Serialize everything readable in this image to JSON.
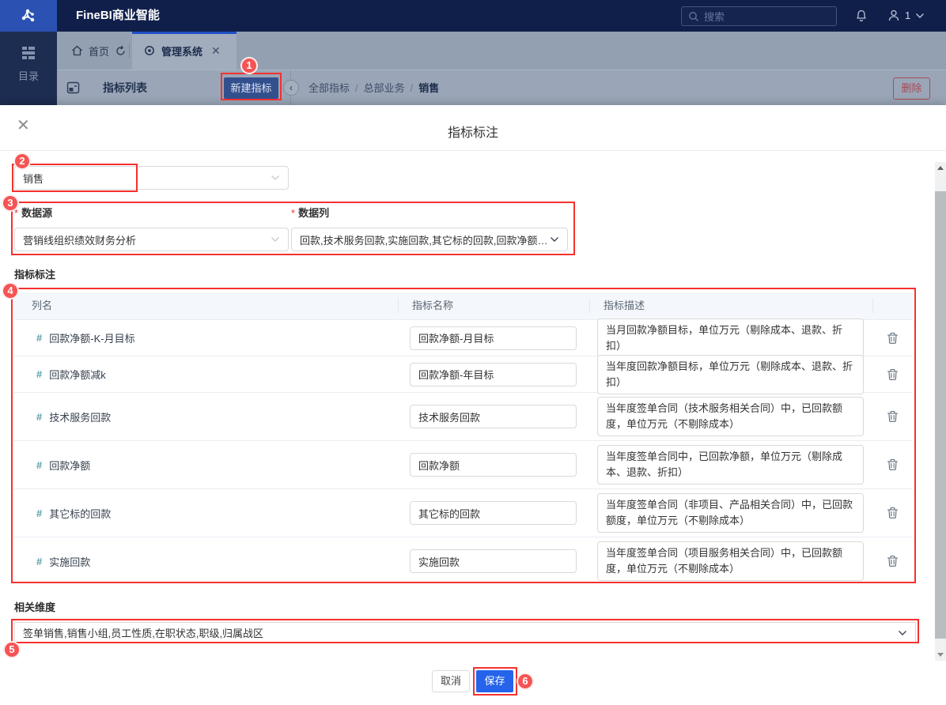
{
  "header": {
    "brand": "FineBI商业智能",
    "search_placeholder": "搜索",
    "user_number": "1"
  },
  "sidebar": {
    "catalog_label": "目录"
  },
  "tabs": {
    "home_label": "首页",
    "active_label": "管理系统"
  },
  "toolbar": {
    "panel_title": "指标列表",
    "new_button_label": "新建指标",
    "breadcrumb": [
      "全部指标",
      "总部业务",
      "销售"
    ],
    "breadcrumb_separator": "/",
    "delete_button_label": "删除"
  },
  "modal": {
    "title": "指标标注",
    "name_value": "销售",
    "required_mark": "*",
    "fields": {
      "datasource": {
        "label": "数据源",
        "value": "营销线组织绩效财务分析"
      },
      "datacolumn": {
        "label": "数据列",
        "value": "回款,技术服务回款,实施回款,其它标的回款,回款净额,回款..."
      }
    },
    "table": {
      "section_label": "指标标注",
      "headers": [
        "列名",
        "指标名称",
        "指标描述"
      ],
      "rows": [
        {
          "column_name": "回款净额-K-月目标",
          "indicator_name": "回款净额-月目标",
          "indicator_desc": "当月回款净额目标，单位万元（剔除成本、退款、折扣）"
        },
        {
          "column_name": "回款净额减k",
          "indicator_name": "回款净额-年目标",
          "indicator_desc": "当年度回款净额目标，单位万元（剔除成本、退款、折扣）"
        },
        {
          "column_name": "技术服务回款",
          "indicator_name": "技术服务回款",
          "indicator_desc": "当年度签单合同（技术服务相关合同）中，已回款额度，单位万元（不剔除成本）"
        },
        {
          "column_name": "回款净额",
          "indicator_name": "回款净额",
          "indicator_desc": "当年度签单合同中，已回款净额，单位万元（剔除成本、退款、折扣）"
        },
        {
          "column_name": "其它标的回款",
          "indicator_name": "其它标的回款",
          "indicator_desc": "当年度签单合同（非项目、产品相关合同）中，已回款额度，单位万元（不剔除成本）"
        },
        {
          "column_name": "实施回款",
          "indicator_name": "实施回款",
          "indicator_desc": "当年度签单合同（项目服务相关合同）中，已回款额度，单位万元（不剔除成本）"
        }
      ]
    },
    "dimensions": {
      "label": "相关维度",
      "value": "签单销售,销售小组,员工性质,在职状态,职级,归属战区"
    },
    "footer": {
      "cancel_label": "取消",
      "save_label": "保存"
    }
  },
  "annotations": {
    "steps": [
      "1",
      "2",
      "3",
      "4",
      "5",
      "6"
    ],
    "colors": {
      "box": "#f5312f",
      "circle": "#f55454"
    }
  }
}
